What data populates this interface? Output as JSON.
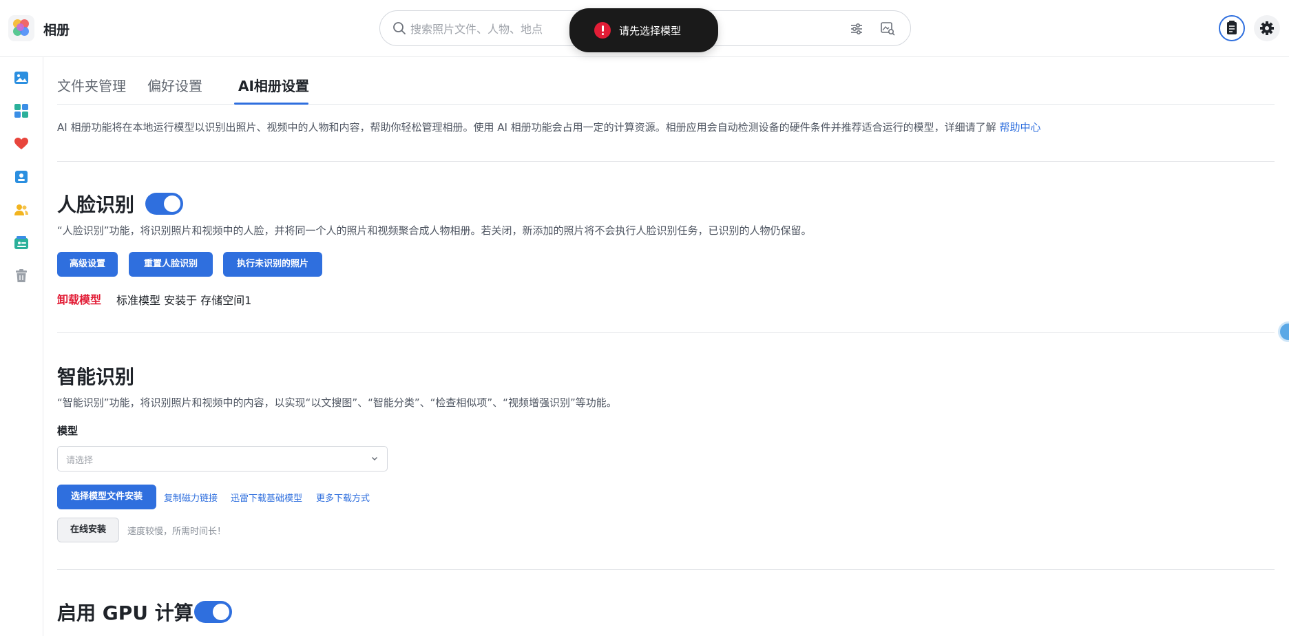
{
  "app": {
    "title": "相册"
  },
  "search": {
    "placeholder": "搜索照片文件、人物、地点",
    "value": ""
  },
  "toast": {
    "message": "请先选择模型"
  },
  "sidebar": {
    "items": [
      {
        "name": "photos",
        "icon": "image-icon"
      },
      {
        "name": "albums",
        "icon": "grid-icon"
      },
      {
        "name": "favorites",
        "icon": "heart-icon"
      },
      {
        "name": "people-album",
        "icon": "id-card-icon"
      },
      {
        "name": "people",
        "icon": "users-icon"
      },
      {
        "name": "shared",
        "icon": "shared-album-icon"
      },
      {
        "name": "trash",
        "icon": "trash-icon"
      }
    ]
  },
  "tabs": [
    {
      "label": "文件夹管理",
      "active": false
    },
    {
      "label": "偏好设置",
      "active": false
    },
    {
      "label": "AI相册设置",
      "active": true
    }
  ],
  "intro": {
    "text": "AI 相册功能将在本地运行模型以识别出照片、视频中的人物和内容，帮助你轻松管理相册。使用 AI 相册功能会占用一定的计算资源。相册应用会自动检测设备的硬件条件并推荐适合运行的模型，详细请了解 ",
    "link": "帮助中心"
  },
  "face": {
    "title": "人脸识别",
    "enabled": true,
    "desc": "“人脸识别”功能，将识别照片和视频中的人脸，并将同一个人的照片和视频聚合成人物相册。若关闭，新添加的照片将不会执行人脸识别任务，已识别的人物仍保留。",
    "buttons": {
      "advanced": "高级设置",
      "reset": "重置人脸识别",
      "run_unrecognized": "执行未识别的照片"
    },
    "uninstall": "卸载模型",
    "model_info": "标准模型 安装于 存储空间1"
  },
  "smart": {
    "title": "智能识别",
    "desc": "“智能识别”功能，将识别照片和视频中的内容，以实现“以文搜图”、“智能分类”、“检查相似项”、“视频增强识别”等功能。",
    "model_label": "模型",
    "select_placeholder": "请选择",
    "install_file_btn": "选择模型文件安装",
    "links": {
      "copy_magnet": "复制磁力链接",
      "thunder": "迅雷下载基础模型",
      "more": "更多下载方式"
    },
    "online_install_btn": "在线安装",
    "online_hint": "速度较慢，所需时间长！"
  },
  "gpu": {
    "title": "启用 GPU 计算",
    "enabled": true
  },
  "colors": {
    "accent": "#2f6fde",
    "danger": "#e21d36",
    "toast_bg": "#1a1a1a"
  }
}
